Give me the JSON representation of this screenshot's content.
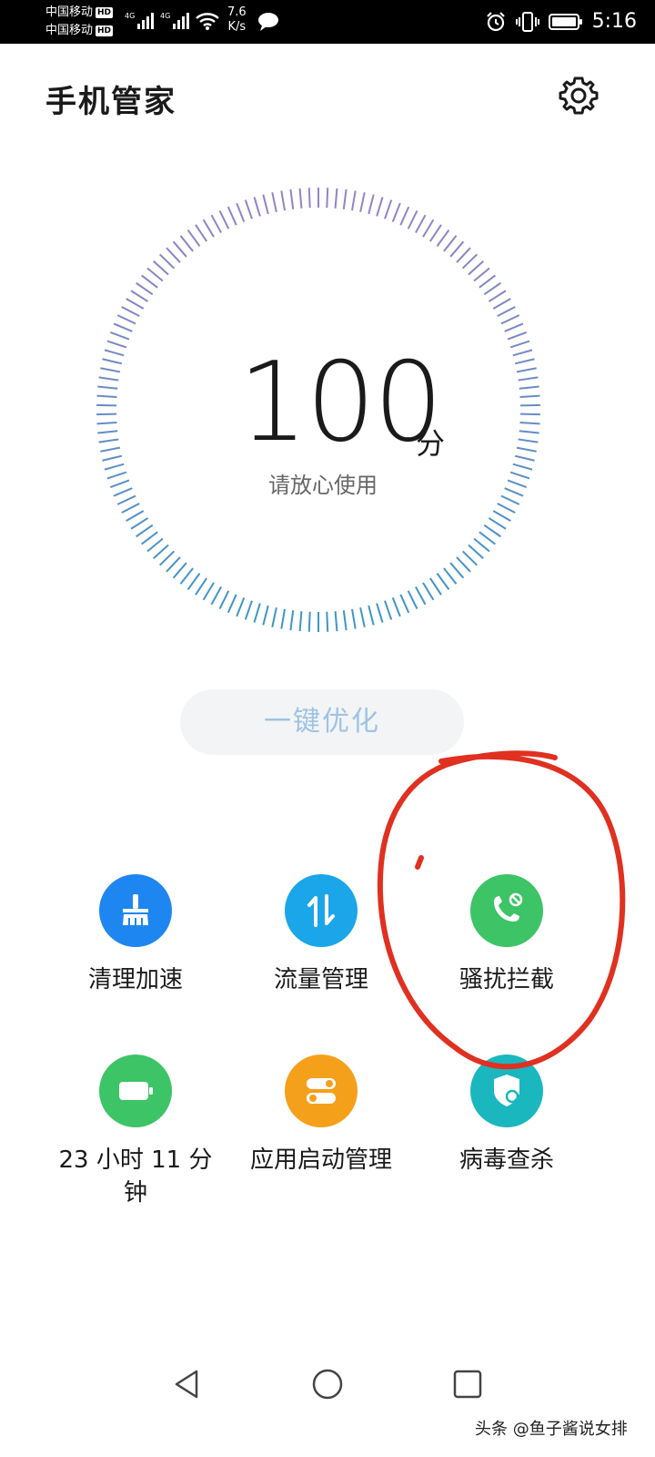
{
  "status_bar": {
    "carrier1": "中国移动",
    "carrier2": "中国移动",
    "hd_badge": "HD",
    "network1": "4G",
    "network2": "4G",
    "speed_value": "7.6",
    "speed_unit": "K/s",
    "time": "5:16",
    "icons": [
      "signal-icon",
      "wifi-icon",
      "message-icon",
      "alarm-icon",
      "vibrate-icon",
      "battery-icon"
    ]
  },
  "header": {
    "title": "手机管家",
    "settings_icon": "gear-icon"
  },
  "score": {
    "value": "100",
    "unit": "分",
    "subtitle": "请放心使用"
  },
  "optimize_button": {
    "label": "一键优化"
  },
  "tools": [
    {
      "label": "清理加速",
      "icon": "broom-icon",
      "color": "#1e86f0"
    },
    {
      "label": "流量管理",
      "icon": "data-transfer-icon",
      "color": "#1aa6e8"
    },
    {
      "label": "骚扰拦截",
      "icon": "call-block-icon",
      "color": "#3cc466"
    },
    {
      "label": "23 小时 11 分\n钟",
      "label_line1": "23 小时 11 分",
      "label_line2": "钟",
      "icon": "battery-icon",
      "color": "#3cc466"
    },
    {
      "label": "应用启动管理",
      "icon": "toggle-icon",
      "color": "#f5a01a"
    },
    {
      "label": "病毒查杀",
      "icon": "shield-search-icon",
      "color": "#1ab7bf"
    }
  ],
  "annotation": {
    "color": "#e03020"
  },
  "nav": {
    "icons": [
      "back-icon",
      "home-icon",
      "recents-icon"
    ]
  },
  "watermark": {
    "text": "头条 @鱼子酱说女排"
  }
}
